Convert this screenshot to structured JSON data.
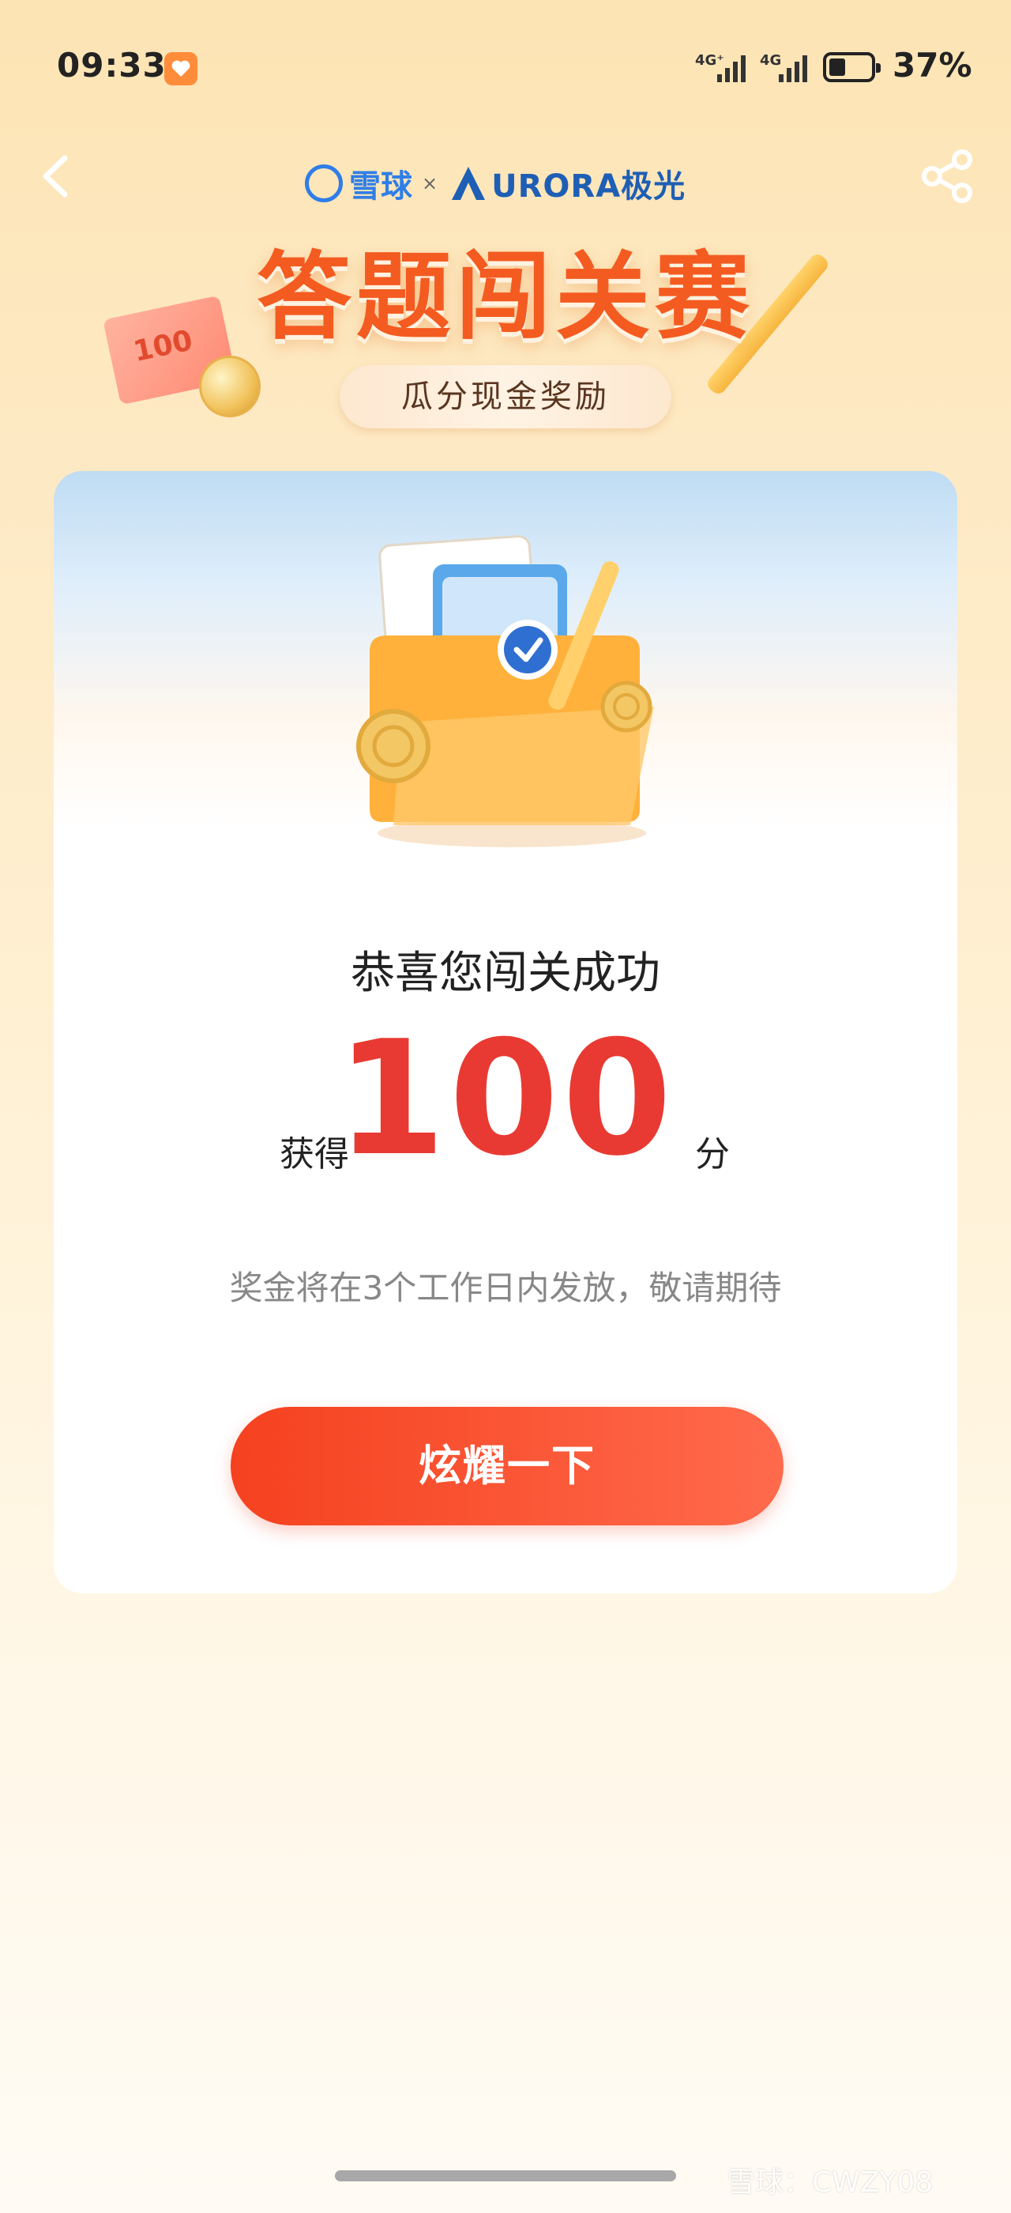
{
  "status_bar": {
    "time": "09:33",
    "network_1": "4G⁺",
    "network_2": "4G",
    "battery": "37%"
  },
  "header": {
    "brand_1": "雪球",
    "times": "×",
    "brand_2": "URORA极光",
    "title": "答题闯关赛",
    "subtitle": "瓜分现金奖励",
    "bill_value": "100"
  },
  "result": {
    "congrats": "恭喜您闯关成功",
    "score_prefix": "获得",
    "score": "100",
    "score_unit": "分",
    "notice": "奖金将在3个工作日内发放，敬请期待",
    "cta": "炫耀一下"
  },
  "watermark": "雪球：CWZY08",
  "colors": {
    "accent": "#f45b20",
    "score": "#e83a33",
    "button": "#f5411f",
    "brand_blue": "#2f7ee8"
  }
}
